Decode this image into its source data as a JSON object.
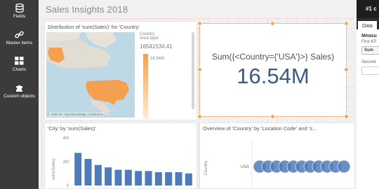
{
  "rail": {
    "items": [
      {
        "label": "Fields",
        "icon": "database-icon"
      },
      {
        "label": "Master items",
        "icon": "link-icon"
      },
      {
        "label": "Charts",
        "icon": "charts-icon"
      },
      {
        "label": "Custom objects",
        "icon": "puzzle-icon"
      }
    ]
  },
  "sheet": {
    "title": "Sales Insights 2018",
    "accent_color": "#f4a556",
    "map_panel": {
      "title": "Distribution of 'sum(Sales)' for 'Country'",
      "legend_title": "Country",
      "legend_layer": "Area layer",
      "legend_max": "16541534.41",
      "legend_tick": "16.54M",
      "attribution": "© 2000 km   OpenStreetMap contributors"
    },
    "kpi_panel": {
      "expression": "Sum({<Country={'USA'}>} Sales)",
      "value": "16.54M"
    },
    "bar_panel": {
      "title": "'City' by 'sum(Sales)'",
      "ylabel": "sum(Sales)",
      "ticks": [
        "4M",
        "2M",
        "0"
      ]
    },
    "scatter_panel": {
      "title": "Overview of 'Country' by 'Location Code' and 's...",
      "ylabel": "Country",
      "category": "USA"
    }
  },
  "chart_data": [
    {
      "type": "bar",
      "title": "'City' by 'sum(Sales)'",
      "ylabel": "sum(Sales)",
      "ylim": [
        0,
        4000000
      ],
      "values": [
        2700000,
        2200000,
        1700000,
        1500000,
        1300000,
        1300000,
        1200000,
        1200000,
        1100000,
        1100000,
        1100000,
        1000000
      ],
      "color": "#4f7bb8"
    },
    {
      "type": "scatter",
      "title": "Overview of 'Country' by 'Location Code' and 's...",
      "ylabel": "Country",
      "categories": [
        "USA"
      ],
      "points": 11,
      "color": "#4f7bb8"
    }
  ],
  "props": {
    "header": "#1 c",
    "tab": "Data",
    "measure_label": "Measu",
    "first_kpi_label": "First KP",
    "field_value": "Sum",
    "second_label": "Second"
  }
}
